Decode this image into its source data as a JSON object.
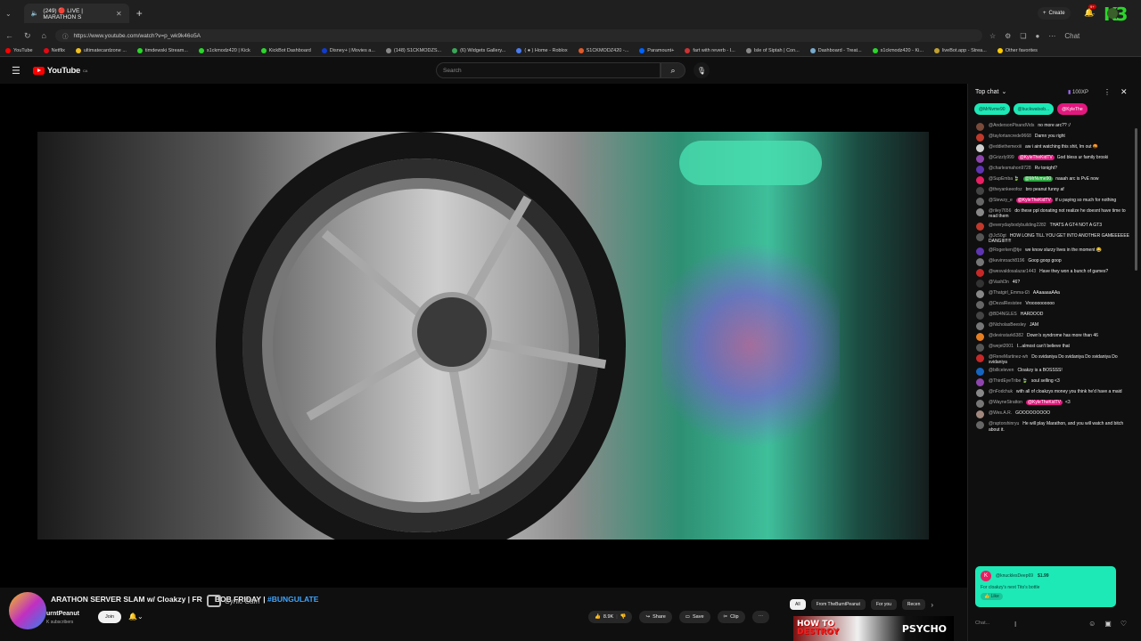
{
  "browser": {
    "tab_title": "(249) 🔴 LIVE | MARATHON S",
    "url": "https://www.youtube.com/watch?v=p_wk9k46o5A",
    "bookmarks": [
      "YouTube",
      "Netflix",
      "ultimatecardzone ...",
      "timdewski Stream...",
      "s1ckmodz420 | Kick",
      "KickBot Dashboard",
      "Disney+ | Movies a...",
      "(148) S1CKMODZS...",
      "(6) Widgets Gallery...",
      "( ● ) Home - Roblox",
      "S1CKMODZ420 -...",
      "Paramount+",
      "fart with reverb - I...",
      "Isle of Siptah | Con...",
      "Dashboard - Treat...",
      "s1ckmodz420 - Ki...",
      "liveBot.app - Strea...",
      "Other favorites"
    ],
    "profile_label": "Chat"
  },
  "youtube": {
    "logo": "YouTube",
    "logo_sup": "CA",
    "search_placeholder": "Search",
    "create_label": "Create",
    "notif_count": "9+"
  },
  "video": {
    "title": "ARATHON SERVER SLAM w/ Cloakzy | FR",
    "title_suffix": "BOB FRIDAY | ",
    "title_tag": "#BUNGULATE",
    "channel": "urntPeanut",
    "subscribers": "K subscribers",
    "join": "Join",
    "cam_text": "Cynic Cam",
    "likes": "8.9K",
    "share": "Share",
    "save": "Save",
    "clip": "Clip"
  },
  "chips": [
    "All",
    "From TheBurntPeanut",
    "For you",
    "Recen"
  ],
  "thumb": {
    "line1": "HOW TO",
    "line2": "DESTROY",
    "right": "PSYCHO"
  },
  "chat": {
    "header": "Top chat",
    "xp": "100XP",
    "donors": [
      {
        "name": "@MrNvme90",
        "color": "#1de9b6",
        "text_color": "#0a3d33"
      },
      {
        "name": "@buckwatsob...",
        "color": "#1de9b6",
        "text_color": "#0a3d33"
      },
      {
        "name": "@KyleThe",
        "color": "#e2187e",
        "text_color": "#ffffff"
      }
    ],
    "messages": [
      {
        "author": "@AndersonPixandVids",
        "text": "no more arc?? :/",
        "color": "#7a4a3a"
      },
      {
        "author": "@taylortancrede9668",
        "text": "Damn you right",
        "color": "#c0392b"
      },
      {
        "author": "@eddiethemexiii",
        "text": "aw i aint watching this shit, Im out 🤬",
        "color": "#d0d0d0"
      },
      {
        "author": "@Grizzly999",
        "hl": "@KyleTheKidTV",
        "text": "God bless ur family broski",
        "color": "#8e44ad"
      },
      {
        "author": "@charlesmahon9728",
        "text": "Rv tonight?",
        "color": "#5e35b1"
      },
      {
        "author": "@SupEmba 🍃",
        "hlg": "@MrNvme90",
        "text": "naaah arc is PvE now",
        "color": "#e91e63"
      },
      {
        "author": "@theyankeeofoz",
        "text": "bro peanut funny af",
        "color": "#444"
      },
      {
        "author": "@Stewzy_e",
        "hl": "@KyleTheKidTV",
        "text": "tf u paying so much for nothing",
        "color": "#666"
      },
      {
        "author": "@riley7656",
        "text": "do these ppl donating not realize he doesnt have time to read them",
        "color": "#888"
      },
      {
        "author": "@everydaybodybuilding2282",
        "text": "THATS A GT4 NOT A GT3",
        "color": "#c0392b"
      },
      {
        "author": "@Jc50gt",
        "text": "HOW LONG TILL YOU GET INTO ANOTHER GAMEEEEEE DANGIII!!!!!",
        "color": "#555"
      },
      {
        "author": "@Rogerken@tje",
        "text": "we know slurzy lives in the moment 😂",
        "color": "#5e35b1"
      },
      {
        "author": "@kevinroach8196",
        "text": "Goop goop goop",
        "color": "#777"
      },
      {
        "author": "@wesvaldosalazar1443",
        "text": "Have they won a bunch of games?",
        "color": "#c62828"
      },
      {
        "author": "@Vashl3n",
        "text": "46?",
        "color": "#333"
      },
      {
        "author": "@Thatgirl_Emma-t2i",
        "text": "AAaaaaaAAa",
        "color": "#888"
      },
      {
        "author": "@DezalResistee",
        "text": "Vroooooooooo",
        "color": "#666"
      },
      {
        "author": "@BD4NGLES",
        "text": "HARDOOD",
        "color": "#444"
      },
      {
        "author": "@NicholasBeesley",
        "text": "JAM",
        "color": "#777"
      },
      {
        "author": "@devinstark6382",
        "text": "Down's syndrome has more than 46",
        "color": "#e67e22"
      },
      {
        "author": "@wejet2001",
        "text": "I...almost can't believe that",
        "color": "#555"
      },
      {
        "author": "@ReneMartinez-wh",
        "text": "Do svidaniya Do svidaniya Do svidaniya Do svidaniya",
        "color": "#c62828"
      },
      {
        "author": "@billceleven",
        "text": "Cloakzy is a BOSSSS!",
        "color": "#1565c0"
      },
      {
        "author": "@ThirdEyeTribe 🍃",
        "text": "soul selling <3",
        "color": "#8e44ad"
      },
      {
        "author": "@nFodchuk",
        "text": "with all of cloakzys money you think he'd have a maid",
        "color": "#888"
      },
      {
        "author": "@WayneStratton",
        "hl": "@KyleTheKidTV",
        "text": "<3",
        "color": "#777"
      },
      {
        "author": "@Wes.A.R.",
        "text": "GOOOOOOOOO",
        "color": "#a1887f"
      },
      {
        "author": "@raptorshinryu",
        "text": "He will play Marathon, and you will watch and bitch about it.",
        "color": "#666"
      }
    ],
    "superchat": {
      "author": "@knucklesDeep69",
      "amount": "$1.99",
      "text": "For cloakzy's next Tito's bottle",
      "like": "Like"
    },
    "input_placeholder": "Chat..."
  }
}
